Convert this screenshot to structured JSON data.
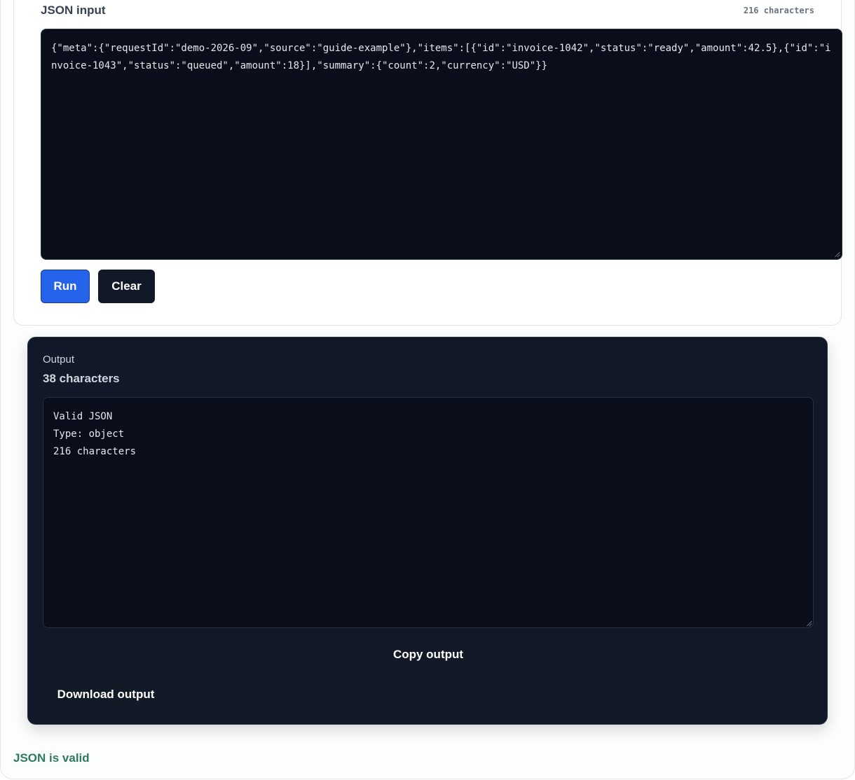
{
  "input": {
    "title": "JSON input",
    "char_count": "216 characters",
    "value": "{\"meta\":{\"requestId\":\"demo-2026-09\",\"source\":\"guide-example\"},\"items\":[{\"id\":\"invoice-1042\",\"status\":\"ready\",\"amount\":42.5},{\"id\":\"invoice-1043\",\"status\":\"queued\",\"amount\":18}],\"summary\":{\"count\":2,\"currency\":\"USD\"}}"
  },
  "actions": {
    "run_label": "Run",
    "clear_label": "Clear"
  },
  "output": {
    "label": "Output",
    "char_count": "38 characters",
    "lines": [
      "Valid JSON",
      "Type: object",
      "216 characters"
    ],
    "copy_label": "Copy output",
    "download_label": "Download output"
  },
  "status": {
    "message": "JSON is valid",
    "color": "#2f7a5f"
  },
  "colors": {
    "accent": "#2563eb",
    "editor_bg": "#0a0e1a",
    "panel_bg": "#111827"
  }
}
